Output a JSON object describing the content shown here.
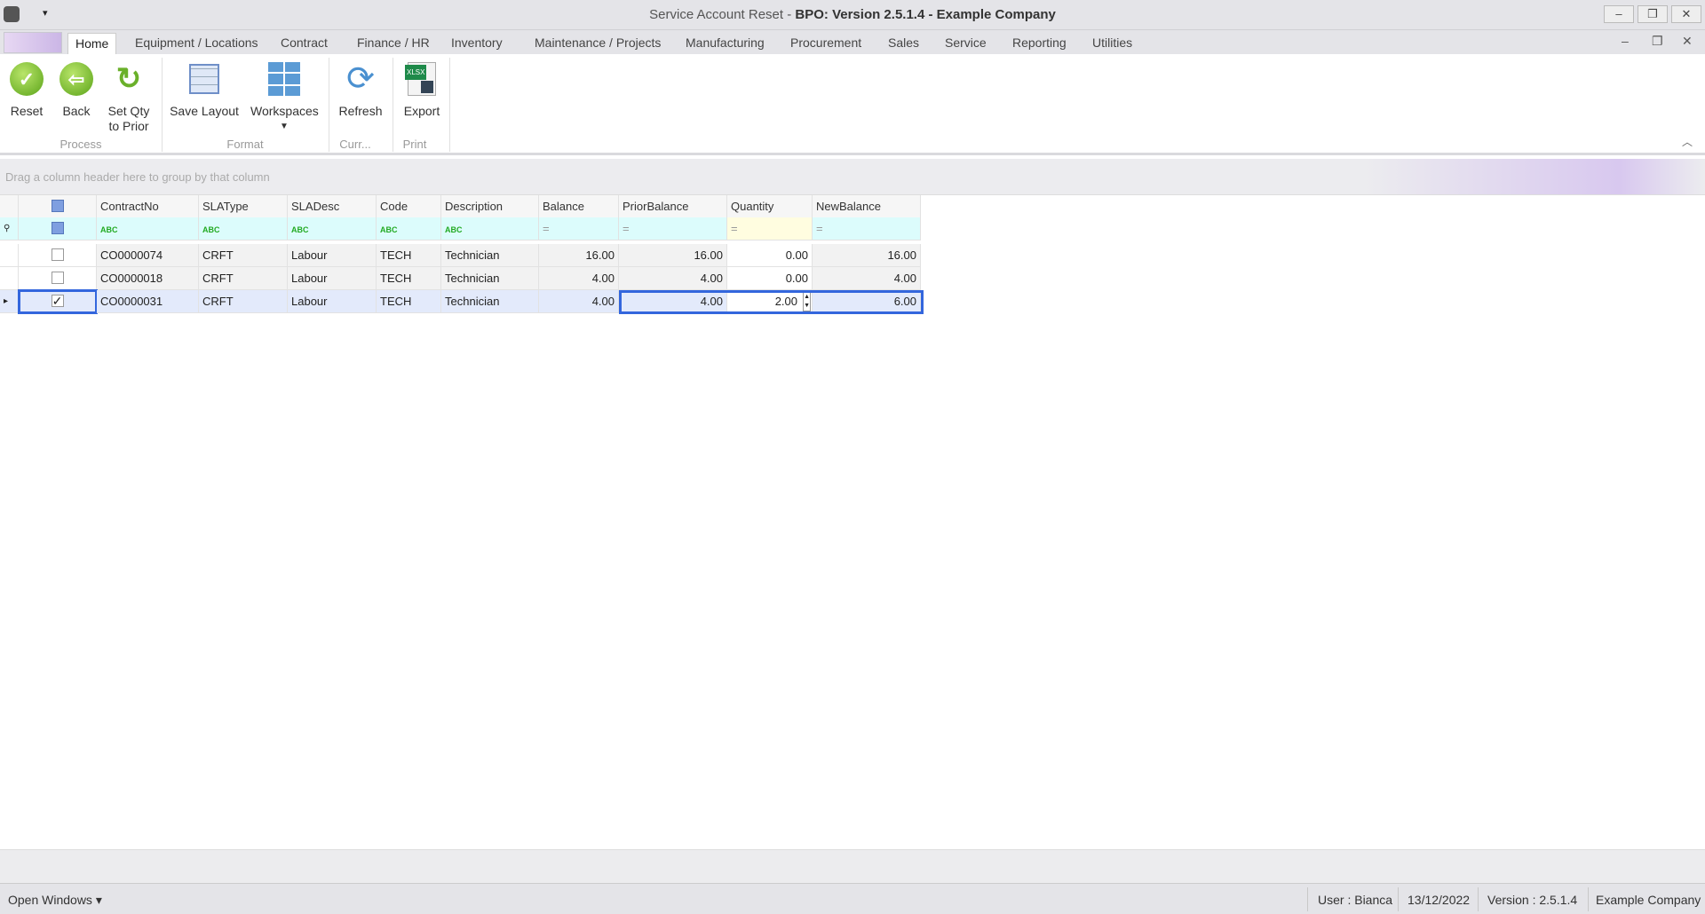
{
  "window": {
    "title_prefix": "Service Account Reset - ",
    "title_main": "BPO: Version 2.5.1.4 - Example Company",
    "minimize": "–",
    "restore": "❐",
    "close": "✕"
  },
  "tabs": [
    "Home",
    "Equipment / Locations",
    "Contract",
    "Finance / HR",
    "Inventory",
    "Maintenance / Projects",
    "Manufacturing",
    "Procurement",
    "Sales",
    "Service",
    "Reporting",
    "Utilities"
  ],
  "ribbon": {
    "buttons": [
      {
        "label": "Reset",
        "icon": "check-icon"
      },
      {
        "label": "Back",
        "icon": "back-arrow-icon"
      },
      {
        "label": "Set Qty to Prior",
        "icon": "refresh-green-icon"
      },
      {
        "label": "Save Layout",
        "icon": "save-layout-icon"
      },
      {
        "label": "Workspaces",
        "icon": "workspaces-icon"
      },
      {
        "label": "Refresh",
        "icon": "refresh-icon"
      },
      {
        "label": "Export",
        "icon": "xlsx-export-icon",
        "badge": "XLSX"
      }
    ],
    "groups": [
      "Process",
      "Format",
      "Curr...",
      "Print"
    ]
  },
  "grid": {
    "group_hint": "Drag a column header here to group by that column",
    "columns": [
      "ContractNo",
      "SLAType",
      "SLADesc",
      "Code",
      "Description",
      "Balance",
      "PriorBalance",
      "Quantity",
      "NewBalance"
    ],
    "filter_text": "ABC",
    "filter_eq": "=",
    "rows": [
      {
        "checked": false,
        "cells": [
          "CO0000074",
          "CRFT",
          "Labour",
          "TECH",
          "Technician",
          "16.00",
          "16.00",
          "0.00",
          "16.00"
        ]
      },
      {
        "checked": false,
        "cells": [
          "CO0000018",
          "CRFT",
          "Labour",
          "TECH",
          "Technician",
          "4.00",
          "4.00",
          "0.00",
          "4.00"
        ]
      },
      {
        "checked": true,
        "cells": [
          "CO0000031",
          "CRFT",
          "Labour",
          "TECH",
          "Technician",
          "4.00",
          "4.00",
          "2.00",
          "6.00"
        ]
      }
    ]
  },
  "status": {
    "open_windows": "Open Windows ▾",
    "user": "User : Bianca",
    "date": "13/12/2022",
    "version": "Version : 2.5.1.4",
    "company": "Example Company"
  },
  "colors": {
    "selection_border": "#3366dd",
    "filter_row": "#dcfcfc",
    "quantity_filter": "#fffde0"
  }
}
